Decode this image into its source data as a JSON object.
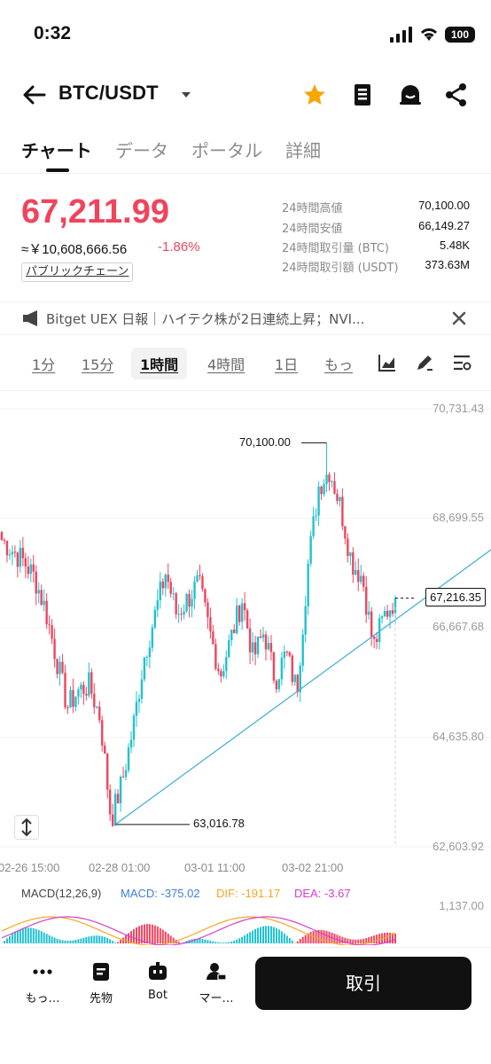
{
  "status_bar": {
    "time": "0:32",
    "battery": "100"
  },
  "header": {
    "pair": "BTC/USDT"
  },
  "tabs": [
    {
      "label": "チャート",
      "active": true
    },
    {
      "label": "データ",
      "active": false
    },
    {
      "label": "ポータル",
      "active": false
    },
    {
      "label": "詳細",
      "active": false
    }
  ],
  "price": {
    "last": "67,211.99",
    "fiat": "≈￥10,608,666.56",
    "change": "-1.86%",
    "chain_link": "パブリックチェーン"
  },
  "stats": [
    {
      "label": "24時間高値",
      "value": "70,100.00"
    },
    {
      "label": "24時間安値",
      "value": "66,149.27"
    },
    {
      "label": "24時間取引量 (BTC)",
      "value": "5.48K"
    },
    {
      "label": "24時間取引額 (USDT)",
      "value": "373.63M"
    }
  ],
  "news": {
    "text": "Bitget UEX 日報｜ハイテク株が2日連続上昇；NVI..."
  },
  "intervals": [
    {
      "label": "1分",
      "active": false
    },
    {
      "label": "15分",
      "active": false
    },
    {
      "label": "1時間",
      "active": true
    },
    {
      "label": "4時間",
      "active": false
    },
    {
      "label": "1日",
      "active": false
    },
    {
      "label": "もっ",
      "active": false
    }
  ],
  "colors": {
    "up": "#22c1cf",
    "down": "#f0445d",
    "accent": "#f7a600",
    "trendline": "#3aaed8"
  },
  "chart_data": {
    "type": "candlestick",
    "y_ticks": [
      "70,731.43",
      "68,699.55",
      "66,667.68",
      "64,635.80",
      "62,603.92"
    ],
    "x_ticks": [
      "02-26 15:00",
      "02-28 01:00",
      "03-01 11:00",
      "03-02 21:00"
    ],
    "ylim": [
      62603.92,
      70731.43
    ],
    "high_label": "70,100.00",
    "low_label": "63,016.78",
    "last_price_label": "67,216.35",
    "high": 70100.0,
    "low": 63016.78,
    "last": 67216.35,
    "close_path": [
      68300,
      68100,
      67900,
      67600,
      67000,
      66100,
      65200,
      65500,
      65600,
      65000,
      63100,
      63800,
      64800,
      66100,
      66900,
      67700,
      66900,
      67200,
      67500,
      66600,
      65800,
      66500,
      67200,
      66100,
      66600,
      65700,
      66200,
      65500,
      67800,
      69300,
      69600,
      68900,
      67900,
      67600,
      66300,
      66900,
      67216
    ],
    "macd": {
      "title": "MACD(12,26,9)",
      "macd": "MACD: -375.02",
      "dif": "DIF: -191.17",
      "dea": "DEA: -3.67",
      "top": "1,137.00"
    }
  },
  "bottom_nav": [
    {
      "label": "もっ…"
    },
    {
      "label": "先物"
    },
    {
      "label": "Bot"
    },
    {
      "label": "マー…"
    }
  ],
  "trade_button": "取引"
}
